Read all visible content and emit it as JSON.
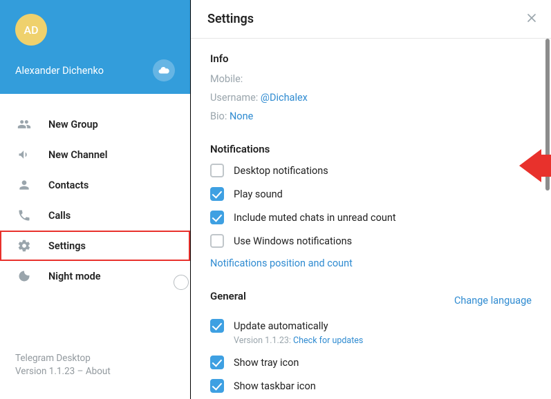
{
  "user": {
    "initials": "AD",
    "name": "Alexander Dichenko"
  },
  "sidebar": {
    "items": [
      {
        "label": "New Group"
      },
      {
        "label": "New Channel"
      },
      {
        "label": "Contacts"
      },
      {
        "label": "Calls"
      },
      {
        "label": "Settings"
      },
      {
        "label": "Night mode"
      }
    ],
    "footer_app": "Telegram Desktop",
    "footer_version": "Version 1.1.23 – About"
  },
  "settings": {
    "title": "Settings",
    "info": {
      "heading": "Info",
      "mobile_label": "Mobile:",
      "username_label": "Username:",
      "username_value": "@Dichalex",
      "bio_label": "Bio:",
      "bio_value": "None"
    },
    "notifications": {
      "heading": "Notifications",
      "opts": [
        {
          "label": "Desktop notifications",
          "checked": false
        },
        {
          "label": "Play sound",
          "checked": true
        },
        {
          "label": "Include muted chats in unread count",
          "checked": true
        },
        {
          "label": "Use Windows notifications",
          "checked": false
        }
      ],
      "position_link": "Notifications position and count"
    },
    "general": {
      "heading": "General",
      "change_language": "Change language",
      "opts": [
        {
          "label": "Update automatically",
          "checked": true
        },
        {
          "label": "Show tray icon",
          "checked": true
        },
        {
          "label": "Show taskbar icon",
          "checked": true
        }
      ],
      "version_line_pre": "Version 1.1.23: ",
      "version_link": "Check for updates"
    }
  }
}
